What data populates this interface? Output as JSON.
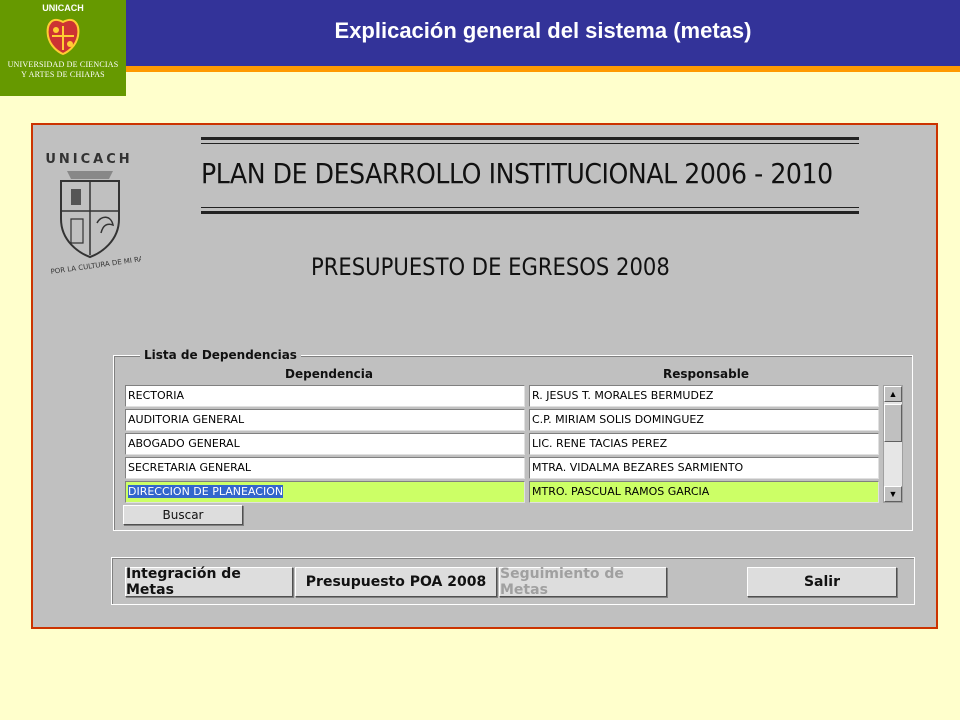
{
  "slide": {
    "title": "Explicación general del sistema  (metas)",
    "logo": {
      "label": "UNICACH",
      "caption_line1": "UNIVERSIDAD DE CIENCIAS",
      "caption_line2": "Y ARTES DE CHIAPAS"
    },
    "colors": {
      "header_bg": "#333399",
      "header_stripe": "#ff9900",
      "logo_bg": "#669900",
      "page_bg": "#ffffcc",
      "window_border": "#cc3300"
    }
  },
  "app": {
    "emblem_label": "UNICACH",
    "emblem_motto": "POR LA CULTURA DE MI RAZA",
    "plan_title": "PLAN DE DESARROLLO INSTITUCIONAL 2006 - 2010",
    "budget_title": "PRESUPUESTO DE EGRESOS 2008",
    "dependencias": {
      "group_label": "Lista de Dependencias",
      "columns": [
        "Dependencia",
        "Responsable"
      ],
      "rows": [
        {
          "dependencia": "RECTORIA",
          "responsable": "R. JESUS T. MORALES BERMUDEZ"
        },
        {
          "dependencia": "AUDITORIA GENERAL",
          "responsable": "C.P. MIRIAM SOLIS DOMINGUEZ"
        },
        {
          "dependencia": "ABOGADO GENERAL",
          "responsable": "LIC. RENE TACIAS PEREZ"
        },
        {
          "dependencia": "SECRETARIA GENERAL",
          "responsable": "MTRA. VIDALMA BEZARES SARMIENTO"
        },
        {
          "dependencia": "DIRECCION DE PLANEACION",
          "responsable": "MTRO. PASCUAL RAMOS GARCIA"
        }
      ],
      "selected_row": 4,
      "search_button": "Buscar"
    },
    "toolbar": {
      "integracion": "Integración de Metas",
      "presupuesto": "Presupuesto POA 2008",
      "seguimiento": "Seguimiento de Metas",
      "salir": "Salir"
    }
  }
}
